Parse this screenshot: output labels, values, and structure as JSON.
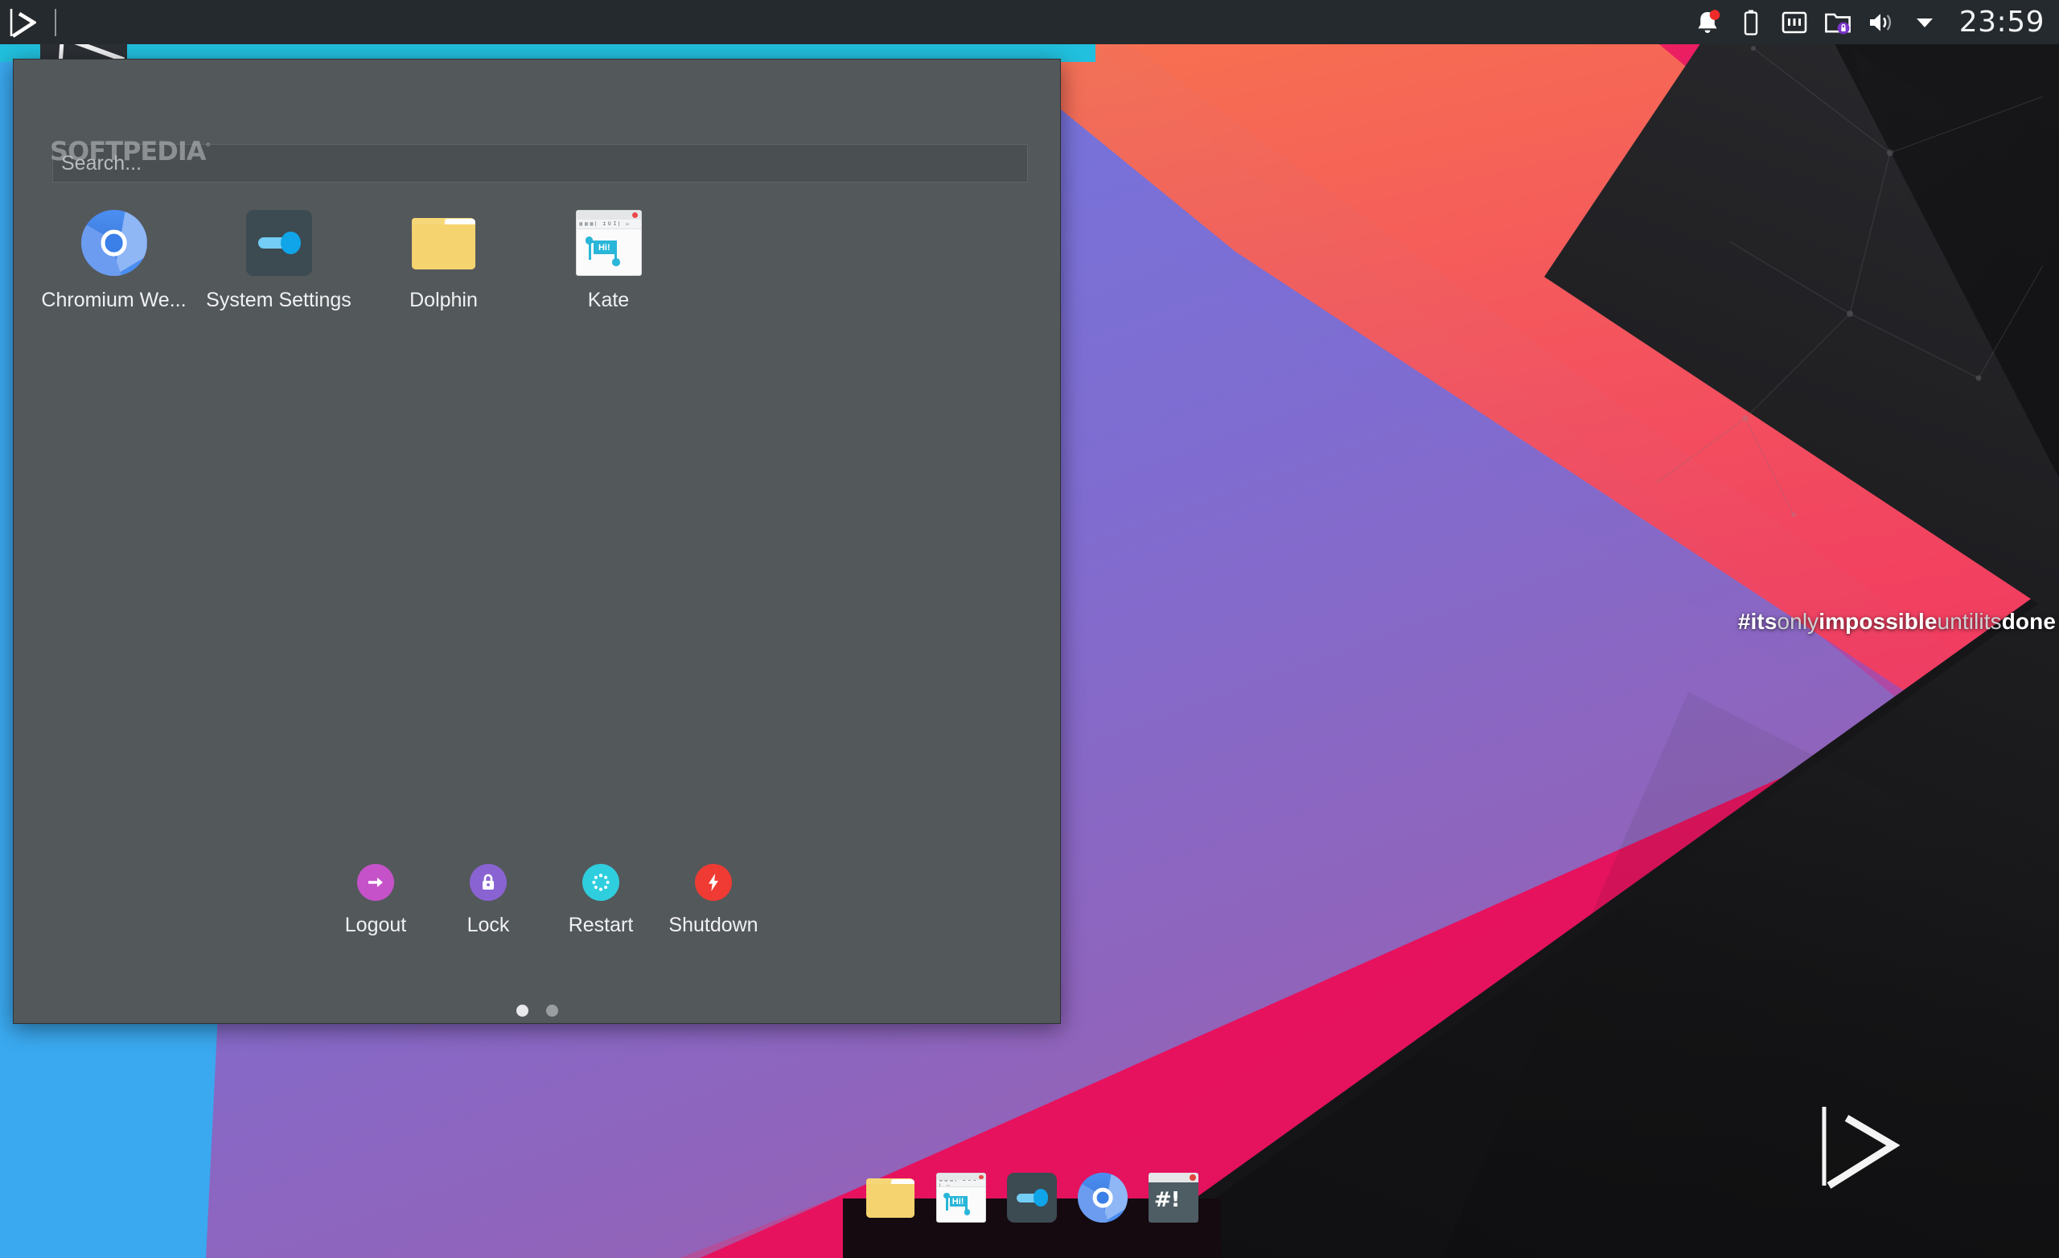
{
  "desktop": {
    "environment": "KDE Plasma desktop",
    "wallpaper_slogan": {
      "segments": [
        {
          "text": "#its",
          "weight": "bold"
        },
        {
          "text": "only",
          "weight": "light"
        },
        {
          "text": "impossible",
          "weight": "bold"
        },
        {
          "text": "untilits",
          "weight": "light"
        },
        {
          "text": "done",
          "weight": "bold"
        }
      ],
      "full_text": "#itsonlyimpossibleuntilitsdone"
    },
    "wallpaper_mark_icon": "play-triangle-outline-icon",
    "colors": {
      "accent_cyan": "#21c0de",
      "panel_bg": "#53585b",
      "topbar_bg": "#252a2e",
      "dock_bg": "#140a10",
      "wallpaper_blue": "#35a8f3",
      "wallpaper_pink": "#ea1560",
      "wallpaper_orange": "#ffa520",
      "wallpaper_purple": "#8f5fc9"
    }
  },
  "topbar": {
    "logo_icon": "play-triangle-outline-icon",
    "separator": "|",
    "tray": [
      {
        "icon": "notification-bell-icon",
        "badge": true,
        "badge_color": "#ee2b28"
      },
      {
        "icon": "battery-icon"
      },
      {
        "icon": "network-ethernet-icon"
      },
      {
        "icon": "folder-lock-icon",
        "badge_color": "#7b35c9"
      },
      {
        "icon": "volume-speaker-icon"
      },
      {
        "icon": "tray-expand-chevron-down-icon"
      }
    ],
    "clock": "23:59"
  },
  "launcher": {
    "watermark": "SOFTPEDIA",
    "watermark_mark": "°",
    "search": {
      "placeholder": "Search...",
      "value": ""
    },
    "apps": [
      {
        "label": "Chromium We...",
        "icon": "chromium-browser-icon"
      },
      {
        "label": "System Settings",
        "icon": "system-settings-toggle-icon"
      },
      {
        "label": "Dolphin",
        "icon": "folder-icon"
      },
      {
        "label": "Kate",
        "icon": "kate-editor-icon"
      }
    ],
    "session_actions": [
      {
        "label": "Logout",
        "icon": "logout-arrow-icon",
        "color": "#c552c9"
      },
      {
        "label": "Lock",
        "icon": "lock-padlock-icon",
        "color": "#8a63d2"
      },
      {
        "label": "Restart",
        "icon": "restart-spinner-icon",
        "color": "#2fcede"
      },
      {
        "label": "Shutdown",
        "icon": "shutdown-bolt-icon",
        "color": "#ef3b33"
      }
    ],
    "pages": {
      "count": 2,
      "active_index": 0
    }
  },
  "dock": {
    "items": [
      {
        "label": "Dolphin",
        "icon": "folder-icon"
      },
      {
        "label": "Kate",
        "icon": "kate-editor-icon"
      },
      {
        "label": "System Settings",
        "icon": "system-settings-toggle-icon"
      },
      {
        "label": "Chromium",
        "icon": "chromium-browser-icon"
      },
      {
        "label": "Terminal",
        "icon": "terminal-shebang-icon",
        "glyph": "#!"
      }
    ]
  }
}
